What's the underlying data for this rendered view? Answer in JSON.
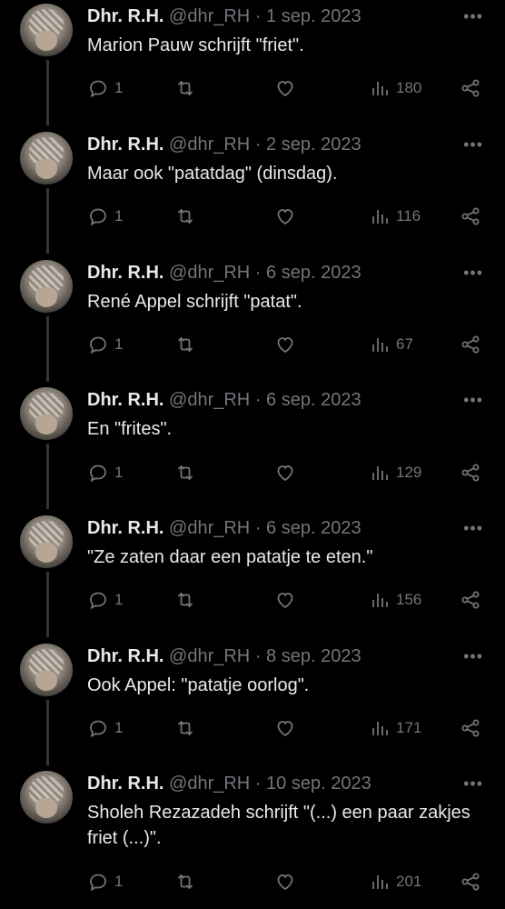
{
  "author": {
    "name": "Dhr. R.H.",
    "handle": "@dhr_RH",
    "separator": "·"
  },
  "icons": {
    "reply": "reply-icon",
    "retweet": "retweet-icon",
    "like": "heart-icon",
    "views": "views-icon",
    "share": "share-icon",
    "more": "more-icon"
  },
  "more_label": "•••",
  "colors": {
    "background": "#000000",
    "text": "#e7e9ea",
    "muted": "#71767b",
    "thread_line": "#333639"
  },
  "tweets": [
    {
      "date": "1 sep. 2023",
      "text": "Marion Pauw schrijft \"friet\".",
      "replies": "1",
      "views": "180"
    },
    {
      "date": "2 sep. 2023",
      "text": "Maar ook \"patatdag\" (dinsdag).",
      "replies": "1",
      "views": "116"
    },
    {
      "date": "6 sep. 2023",
      "text": "René Appel schrijft \"patat\".",
      "replies": "1",
      "views": "67"
    },
    {
      "date": "6 sep. 2023",
      "text": "En \"frites\".",
      "replies": "1",
      "views": "129"
    },
    {
      "date": "6 sep. 2023",
      "text": "\"Ze zaten daar een patatje te eten.\"",
      "replies": "1",
      "views": "156"
    },
    {
      "date": "8 sep. 2023",
      "text": "Ook Appel: \"patatje oorlog\".",
      "replies": "1",
      "views": "171"
    },
    {
      "date": "10 sep. 2023",
      "text": "Sholeh Rezazadeh schrijft \"(...) een paar zakjes friet (...)\".",
      "replies": "1",
      "views": "201"
    }
  ]
}
